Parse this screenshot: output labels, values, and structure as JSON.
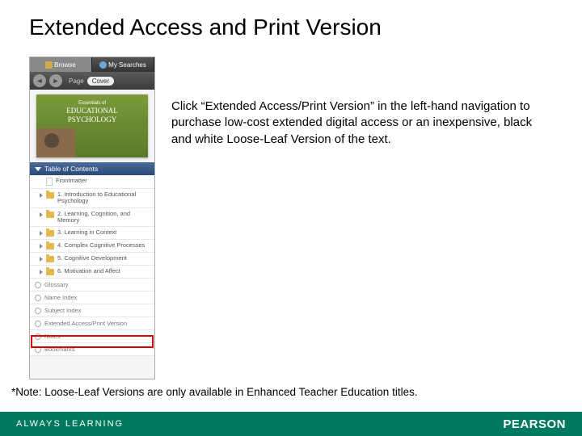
{
  "title": "Extended Access and Print Version",
  "screenshot": {
    "tabs": {
      "browse": "Browse",
      "searches": "My Searches"
    },
    "toolbar": {
      "page": "Page",
      "cover": "Cover"
    },
    "cover": {
      "pretitle": "Essentials of",
      "title1": "EDUCATIONAL",
      "title2": "PSYCHOLOGY"
    },
    "toc_header": "Table of Contents",
    "toc": [
      {
        "type": "doc",
        "label": "Frontmatter"
      },
      {
        "type": "folder",
        "label": "1. Introduction to Educational Psychology"
      },
      {
        "type": "folder",
        "label": "2. Learning, Cognition, and Memory"
      },
      {
        "type": "folder",
        "label": "3. Learning in Context"
      },
      {
        "type": "folder",
        "label": "4. Complex Cognitive Processes"
      },
      {
        "type": "folder",
        "label": "5. Cognitive Development"
      },
      {
        "type": "folder",
        "label": "6. Motivation and Affect"
      }
    ],
    "links": [
      "Glossary",
      "Name Index",
      "Subject Index",
      "Extended Access/Print Version",
      "Notes",
      "Bookmarks"
    ]
  },
  "body_text": "Click “Extended Access/Print Version” in the left-hand navigation to purchase low-cost extended digital access or an inexpensive, black and white Loose-Leaf Version of the text.",
  "note": "*Note: Loose-Leaf Versions are only available in Enhanced Teacher Education titles.",
  "footer": {
    "tagline": "ALWAYS LEARNING",
    "brand": "PEARSON"
  }
}
